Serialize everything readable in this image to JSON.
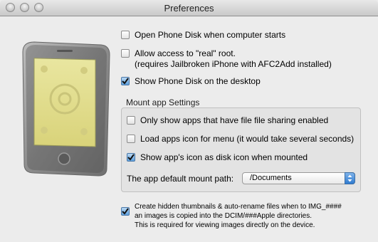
{
  "window": {
    "title": "Preferences"
  },
  "options": {
    "open_on_start": {
      "label": "Open Phone Disk when computer starts",
      "checked": false
    },
    "allow_root": {
      "label_line1": "Allow access to \"real\" root.",
      "label_line2": "(requires Jailbroken iPhone with AFC2Add installed)",
      "checked": false
    },
    "show_on_desktop": {
      "label": "Show Phone Disk on the desktop",
      "checked": true
    }
  },
  "mount_settings": {
    "title": "Mount app Settings",
    "only_sharing": {
      "label": "Only show apps that have file file sharing enabled",
      "checked": false
    },
    "load_icons": {
      "label": "Load apps icon for menu  (it would take several seconds)",
      "checked": false
    },
    "app_icon_disk": {
      "label": "Show app's icon as disk icon when mounted",
      "checked": true
    },
    "mount_path_label": "The app default mount path:",
    "mount_path_value": "/Documents"
  },
  "thumbnails": {
    "line1": "Create hidden thumbnails & auto-rename files when to IMG_####",
    "line2": "an images is copied into the DCIM/###Apple directories.",
    "line3": "This is required for viewing images directly on the device.",
    "checked": true
  },
  "icons": {
    "traffic_lights": [
      "close-icon",
      "minimize-icon",
      "zoom-icon"
    ],
    "illustration": "phone-icon",
    "checkmark": "checkmark-icon",
    "popup": "updown-arrows-icon"
  },
  "colors": {
    "window_bg": "#ececec",
    "check_blue": "#5e9fdc",
    "popup_blue": "#2f7bd0",
    "phone_screen": "#e3e08e"
  }
}
